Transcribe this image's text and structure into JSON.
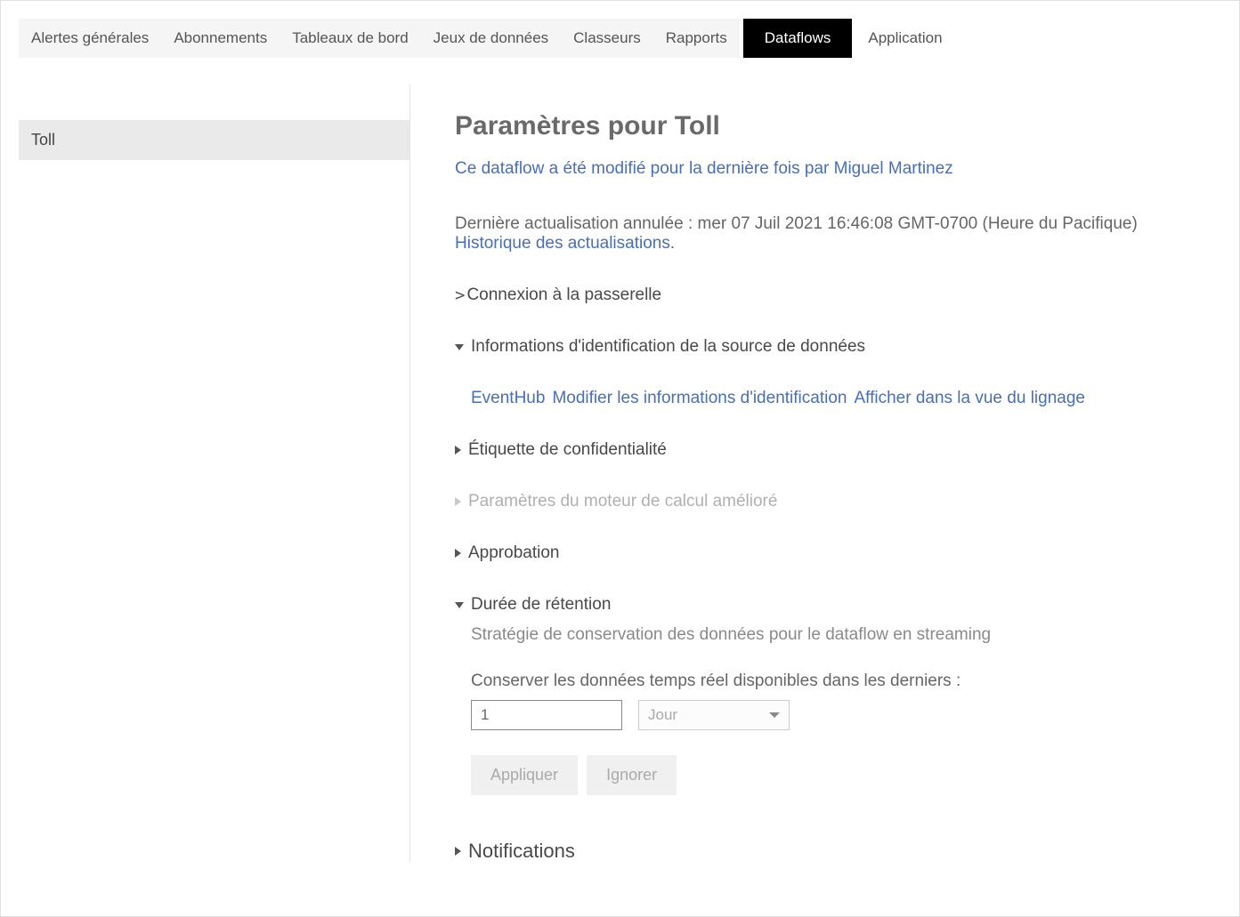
{
  "tabs": {
    "general_alerts": "Alertes générales",
    "subscriptions": "Abonnements",
    "dashboards": "Tableaux de bord",
    "datasets": "Jeux de données",
    "workbooks": "Classeurs",
    "reports": "Rapports",
    "dataflows": "Dataflows",
    "application": "Application"
  },
  "sidebar": {
    "items": [
      {
        "label": "Toll"
      }
    ]
  },
  "main": {
    "title": "Paramètres pour Toll",
    "modified_by": "Ce dataflow a été modifié pour la dernière fois par Miguel Martinez",
    "last_refresh": "Dernière actualisation annulée : mer 07 Juil 2021 16:46:08 GMT-0700 (Heure du Pacifique)",
    "refresh_history": "Historique des actualisations",
    "period": ".",
    "gateway_connection": "Connexion à la passerelle",
    "ds_credentials_title": "Informations d'identification de la source de données",
    "ds_source": "EventHub",
    "ds_edit_credentials": "Modifier les informations d'identification",
    "ds_lineage_view": "Afficher dans la vue du lignage",
    "sensitivity_label": "Étiquette de confidentialité",
    "enhanced_engine": "Paramètres du moteur de calcul amélioré",
    "endorsement": "Approbation",
    "retention_title": "Durée de rétention",
    "retention_subtitle": "Stratégie de conservation des données pour le dataflow en streaming",
    "retention_label": "Conserver les données temps réel disponibles dans les derniers :",
    "retention_value": "1",
    "retention_unit": "Jour",
    "apply_button": "Appliquer",
    "discard_button": "Ignorer",
    "notifications": "Notifications"
  }
}
